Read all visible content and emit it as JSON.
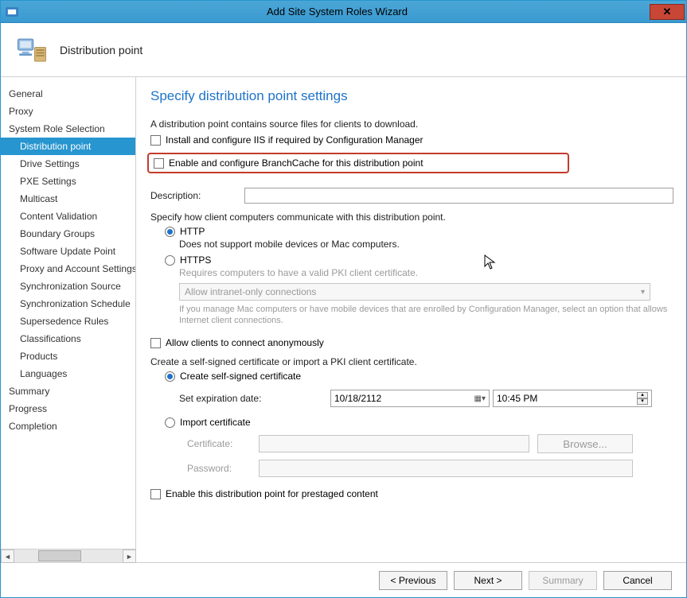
{
  "window": {
    "title": "Add Site System Roles Wizard",
    "header_label": "Distribution point"
  },
  "sidebar": {
    "items": [
      {
        "label": "General",
        "sub": false
      },
      {
        "label": "Proxy",
        "sub": false
      },
      {
        "label": "System Role Selection",
        "sub": false
      },
      {
        "label": "Distribution point",
        "sub": true,
        "selected": true
      },
      {
        "label": "Drive Settings",
        "sub": true
      },
      {
        "label": "PXE Settings",
        "sub": true
      },
      {
        "label": "Multicast",
        "sub": true
      },
      {
        "label": "Content Validation",
        "sub": true
      },
      {
        "label": "Boundary Groups",
        "sub": true
      },
      {
        "label": "Software Update Point",
        "sub": true
      },
      {
        "label": "Proxy and Account Settings",
        "sub": true
      },
      {
        "label": "Synchronization Source",
        "sub": true
      },
      {
        "label": "Synchronization Schedule",
        "sub": true
      },
      {
        "label": "Supersedence Rules",
        "sub": true
      },
      {
        "label": "Classifications",
        "sub": true
      },
      {
        "label": "Products",
        "sub": true
      },
      {
        "label": "Languages",
        "sub": true
      },
      {
        "label": "Summary",
        "sub": false
      },
      {
        "label": "Progress",
        "sub": false
      },
      {
        "label": "Completion",
        "sub": false
      }
    ]
  },
  "main": {
    "title": "Specify distribution point settings",
    "intro": "A distribution point contains source files for clients to download.",
    "cb_iis": "Install and configure IIS if required by Configuration Manager",
    "cb_branchcache": "Enable and configure BranchCache for this distribution point",
    "desc_label": "Description:",
    "desc_value": "",
    "comm_text": "Specify how client computers communicate with this distribution point.",
    "http_label": "HTTP",
    "http_sub": "Does not support mobile devices or Mac computers.",
    "https_label": "HTTPS",
    "https_sub": "Requires computers to have a valid PKI client certificate.",
    "conn_option": "Allow intranet-only connections",
    "conn_hint": "If you manage Mac computers or have mobile devices that are enrolled by Configuration Manager, select an option that allows Internet client connections.",
    "cb_anon": "Allow clients to connect anonymously",
    "cert_text": "Create a self-signed certificate or import a PKI client certificate.",
    "r_selfsigned": "Create self-signed certificate",
    "exp_label": "Set expiration date:",
    "exp_date": "10/18/2112",
    "exp_time": "10:45 PM",
    "r_import": "Import certificate",
    "cert_label": "Certificate:",
    "pass_label": "Password:",
    "browse": "Browse...",
    "cb_prestaged": "Enable this distribution point for prestaged content"
  },
  "footer": {
    "previous": "< Previous",
    "next": "Next >",
    "summary": "Summary",
    "cancel": "Cancel"
  }
}
